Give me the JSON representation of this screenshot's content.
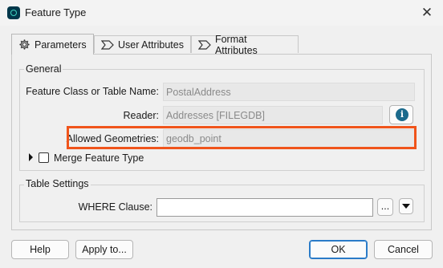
{
  "window": {
    "title": "Feature Type",
    "close_glyph": "✕"
  },
  "tabs": [
    {
      "label": "Parameters",
      "icon": "gear-icon"
    },
    {
      "label": "User Attributes",
      "icon": "tag-icon"
    },
    {
      "label": "Format Attributes",
      "icon": "tag-icon"
    }
  ],
  "general": {
    "group_label": "General",
    "feature_class_label": "Feature Class or Table Name:",
    "feature_class_value": "PostalAddress",
    "reader_label": "Reader:",
    "reader_value": "Addresses [FILEGDB]",
    "info_glyph": "i",
    "allowed_geometries_label": "Allowed Geometries:",
    "allowed_geometries_value": "geodb_point"
  },
  "merge": {
    "label": "Merge Feature Type",
    "checked": false
  },
  "table_settings": {
    "group_label": "Table Settings",
    "where_label": "WHERE Clause:",
    "where_value": "",
    "browse_label": "...",
    "colors": {
      "highlight": "#f0541b"
    }
  },
  "footer": {
    "help_label": "Help",
    "apply_label": "Apply to...",
    "ok_label": "OK",
    "cancel_label": "Cancel"
  }
}
